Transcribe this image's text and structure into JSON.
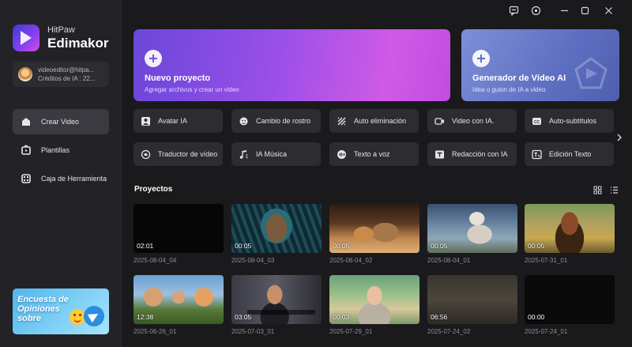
{
  "app": {
    "brand_small": "HitPaw",
    "brand_big": "Edimakor"
  },
  "account": {
    "email": "videoeditor@hitpa...",
    "credits": "Créditos de IA : 22..."
  },
  "nav": [
    {
      "label": "Crear Video",
      "icon": "home-icon",
      "active": true
    },
    {
      "label": "Plantillas",
      "icon": "template-icon",
      "active": false
    },
    {
      "label": "Caja de Herramienta",
      "icon": "toolbox-icon",
      "active": false
    }
  ],
  "banner": {
    "text": "Encuesta de Opiniones sobre"
  },
  "titlebar": {
    "icons": [
      "feedback-icon",
      "settings-icon",
      "minimize-icon",
      "maximize-icon",
      "close-icon"
    ]
  },
  "hero": [
    {
      "title": "Nuevo proyecto",
      "subtitle": "Agregar archivos y crear un video"
    },
    {
      "title": "Generador de Vídeo AI",
      "subtitle": "Idea o guion de IA a video"
    }
  ],
  "tools": [
    {
      "label": "Avatar IA",
      "icon": "avatar-icon"
    },
    {
      "label": "Cambio de rostro",
      "icon": "face-swap-icon"
    },
    {
      "label": "Auto eliminación",
      "icon": "auto-remove-icon"
    },
    {
      "label": "Video con IA.",
      "icon": "ai-video-icon"
    },
    {
      "label": "Auto-subtítulos",
      "icon": "subtitles-icon"
    },
    {
      "label": "Traductor de vídeo",
      "icon": "translate-icon"
    },
    {
      "label": "IA Música",
      "icon": "music-icon"
    },
    {
      "label": "Texto a voz",
      "icon": "text-to-speech-icon"
    },
    {
      "label": "Redacción con IA",
      "icon": "ai-writing-icon"
    },
    {
      "label": "Edición Texto",
      "icon": "text-edit-icon"
    }
  ],
  "projects": {
    "title": "Proyectos",
    "items": [
      {
        "name": "2025-08-04_04",
        "duration": "02:01"
      },
      {
        "name": "2025-08-04_03",
        "duration": "00:05"
      },
      {
        "name": "2025-08-04_02",
        "duration": "00:05"
      },
      {
        "name": "2025-08-04_01",
        "duration": "00:05"
      },
      {
        "name": "2025-07-31_01",
        "duration": "00:05"
      },
      {
        "name": "2025-06-26_01",
        "duration": "12:38"
      },
      {
        "name": "2025-07-03_01",
        "duration": "03:05"
      },
      {
        "name": "2025-07-29_01",
        "duration": "00:03"
      },
      {
        "name": "2025-07-24_02",
        "duration": "06:56"
      },
      {
        "name": "2025-07-24_01",
        "duration": "00:00"
      }
    ]
  },
  "colors": {
    "background": "#1a1a1d",
    "sidebar": "#232327",
    "tool_button": "#2c2c31",
    "nav_active": "#3a3a40",
    "hero_gradient_start": "#6a47d8",
    "hero_gradient_end": "#d05ae6"
  }
}
